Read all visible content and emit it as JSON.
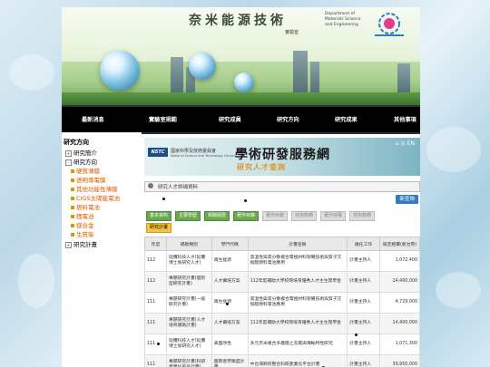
{
  "header": {
    "title": "奈米能源技術",
    "subtitle": "實驗室",
    "dept_en": "Department of Materials Science and Engineering"
  },
  "nav": [
    "最新消息",
    "實驗室規範",
    "研究成員",
    "研究方向",
    "研究成果",
    "其他事項"
  ],
  "sidebar": {
    "heading": "研究方向",
    "items": [
      {
        "label": "研究簡介",
        "type": "main",
        "expander": "+"
      },
      {
        "label": "研究方向",
        "type": "main",
        "expander": "-"
      },
      {
        "label": "硬質薄膜",
        "type": "sub"
      },
      {
        "label": "透明導電膜",
        "type": "sub"
      },
      {
        "label": "其他功能性薄膜",
        "type": "sub"
      },
      {
        "label": "CIGS太陽能電池",
        "type": "sub"
      },
      {
        "label": "燃料電池",
        "type": "sub"
      },
      {
        "label": "鋰電池",
        "type": "sub"
      },
      {
        "label": "鎂合金",
        "type": "sub"
      },
      {
        "label": "生質柴",
        "type": "sub"
      },
      {
        "label": "研究計畫",
        "type": "main",
        "expander": "+"
      }
    ]
  },
  "banner": {
    "org_logo": "NSTC",
    "org_name": "國家科學及技術委員會",
    "org_name_en": "National Science and Technology Council",
    "title": "學術研發服務網",
    "subtitle": "研究人才查詢",
    "lang": "EN"
  },
  "breadcrumb": "研究人才詳細資料",
  "new_query_button": "新查詢",
  "tabs": [
    {
      "label": "基本資料",
      "state": "normal"
    },
    {
      "label": "主要學歷",
      "state": "normal"
    },
    {
      "label": "相關經歷",
      "state": "normal"
    },
    {
      "label": "著作目錄",
      "state": "normal"
    },
    {
      "label": "著作目錄",
      "state": "disabled"
    },
    {
      "label": "技術移轉",
      "state": "disabled"
    },
    {
      "label": "著作授權",
      "state": "disabled"
    },
    {
      "label": "技術移轉",
      "state": "disabled"
    },
    {
      "label": "研究計畫",
      "state": "active"
    }
  ],
  "table": {
    "headers": [
      "年度",
      "補助類別",
      "學門代碼",
      "計畫名稱",
      "擔任工作",
      "核定經費(新台幣)"
    ],
    "rows": [
      {
        "year": "112",
        "type": "延攬科技人才(延攬博士後研究人才)",
        "field": "再生能源",
        "name": "高溫性與高分散複合電極材料製備技術與質子交換膜燃料電池應用",
        "role": "計畫主持人",
        "amount": "1,072,400"
      },
      {
        "year": "112",
        "type": "專題研究計畫(個別型研究計畫)",
        "field": "人才攝培方案",
        "name": "112年度補助大學校院培育優秀人才主生獎學金",
        "role": "計畫主持人",
        "amount": "14,400,000"
      },
      {
        "year": "111",
        "type": "專題研究計畫(一般研究計畫)",
        "field": "再生能源",
        "name": "高溫性與高分散複合電極材料製備技術與質子交換膜燃料電池應用",
        "role": "計畫主持人",
        "amount": "4,729,000"
      },
      {
        "year": "111",
        "type": "專題研究計畫(人才培育補助計畫)",
        "field": "人才攝培方案",
        "name": "111年度補助大學校院培育優秀人才主生獎學金",
        "role": "計畫主持人",
        "amount": "14,400,000"
      },
      {
        "year": "111",
        "type": "延攬科技人才(延攬博士後研究人才)",
        "field": "表面改性",
        "name": "多元奈米複合多層膜之充電與傳輸特性研究",
        "role": "計畫主持人",
        "amount": "1,071,300"
      },
      {
        "year": "111",
        "type": "專題研究計畫(科研產業化平台計畫)",
        "field": "國際產學聯盟計畫",
        "name": "中台灣跨校整合科研產業化平台計畫",
        "role": "計畫主持人",
        "amount": "39,950,000"
      }
    ]
  }
}
